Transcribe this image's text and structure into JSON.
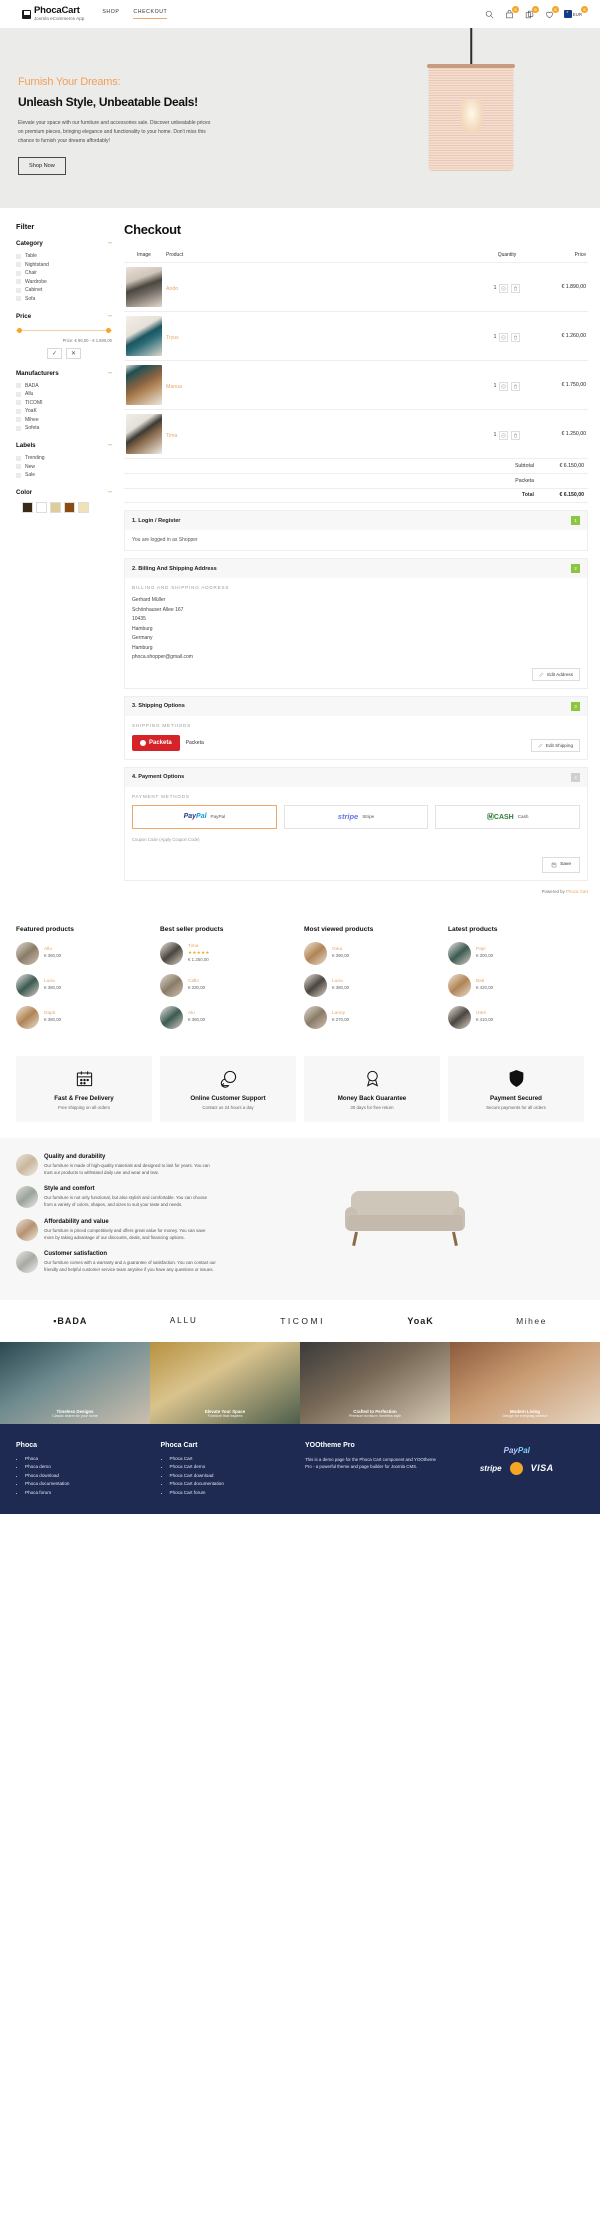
{
  "header": {
    "brand_name": "PhocaCart",
    "brand_sub": "Joomla eCommerce App",
    "nav": [
      {
        "label": "SHOP",
        "active": false
      },
      {
        "label": "CHECKOUT",
        "active": true
      }
    ],
    "icons": {
      "search": "search-icon",
      "cart_badge": "0",
      "compare_badge": "0",
      "wishlist_badge": "0",
      "lang_badge": "0",
      "lang_label": "EUR"
    }
  },
  "hero": {
    "eyebrow": "Furnish Your Dreams:",
    "title": "Unleash Style, Unbeatable Deals!",
    "desc": "Elevate your space with our furniture and accessories sale. Discover unbeatable prices on premium pieces, bringing elegance and functionality to your home. Don't miss this chance to furnish your dreams affordably!",
    "button": "Shop Now"
  },
  "filter": {
    "title": "Filter",
    "groups": [
      {
        "name": "Category",
        "items": [
          "Table",
          "Nightstand",
          "Chair",
          "Wardrobe",
          "Cabinet",
          "Sofa"
        ]
      },
      {
        "name": "Manufacturers",
        "items": [
          "BADA",
          "Allu",
          "TICOMI",
          "YoaK",
          "Mihee",
          "Sofeta"
        ]
      },
      {
        "name": "Labels",
        "items": [
          "Trending",
          "New",
          "Sale"
        ]
      }
    ],
    "price": {
      "name": "Price",
      "range_text": "Price: € 90,00 - € 1.890,00",
      "apply_icon": "check-circle-icon",
      "reset_icon": "cancel-circle-icon"
    },
    "color": {
      "name": "Color",
      "swatches": [
        "#3b2a16",
        "#ffffff",
        "#e0cc9a",
        "#8a4c10",
        "#efe3b6"
      ]
    }
  },
  "checkout": {
    "title": "Checkout",
    "columns": [
      "Image",
      "Product",
      "Quantity",
      "Price"
    ],
    "rows": [
      {
        "thumb": "t1",
        "product": "Ando",
        "qty": "1",
        "price": "€ 1.890,00"
      },
      {
        "thumb": "t2",
        "product": "Tryus",
        "qty": "1",
        "price": "€ 1.260,00"
      },
      {
        "thumb": "t3",
        "product": "Manua",
        "qty": "1",
        "price": "€ 1.750,00"
      },
      {
        "thumb": "t4",
        "product": "Tima",
        "qty": "1",
        "price": "€ 1.250,00"
      }
    ],
    "summary": [
      {
        "label": "Subtotal",
        "value": "€ 6.150,00"
      },
      {
        "label": "Packeta",
        "value": ""
      },
      {
        "label": "Total",
        "value": "€ 6.150,00"
      }
    ],
    "steps": [
      {
        "title": "1. Login / Register",
        "num": "1",
        "note": "You are logged in as Shopper"
      },
      {
        "title": "2. Billing And Shipping Address",
        "num": "2",
        "section_label": "BILLING AND SHIPPING ADDRESS",
        "address": [
          "Gerhard Müller",
          "Schönhauser Allee 167",
          "10435",
          "Hamburg",
          "Germany",
          "Hamburg",
          "phoca.shopper@gmail.com"
        ],
        "edit_label": "Edit Address"
      },
      {
        "title": "3. Shipping Options",
        "num": "3",
        "section_label": "SHIPPING METHODS",
        "method_logo": "Packeta",
        "method_name": "Packeta",
        "edit_label": "Edit Shipping"
      },
      {
        "title": "4. Payment Options",
        "num": "4",
        "section_label": "PAYMENT METHODS",
        "methods": [
          {
            "logo": "PayPal",
            "label": "PayPal",
            "selected": true
          },
          {
            "logo": "stripe",
            "label": "Stripe",
            "selected": false
          },
          {
            "logo": "CASH",
            "label": "Cash",
            "selected": false
          }
        ],
        "coupon_label": "Coupon Code",
        "coupon_hint": "(Apply Coupon Code)",
        "save_label": "Save"
      }
    ],
    "powered_prefix": "Powered by ",
    "powered_link": "Phoca Cart"
  },
  "product_columns": [
    {
      "heading": "Featured products",
      "items": [
        {
          "thumb": "pa",
          "name": "Allu",
          "stars": "",
          "price": "€ 360,00"
        },
        {
          "thumb": "pb",
          "name": "Luea",
          "stars": "",
          "price": "€ 380,00"
        },
        {
          "thumb": "pc",
          "name": "Dapit",
          "stars": "",
          "price": "€ 380,00"
        }
      ]
    },
    {
      "heading": "Best seller products",
      "items": [
        {
          "thumb": "pd",
          "name": "Tima",
          "stars": "★★★★★",
          "price": "€ 1.250,00"
        },
        {
          "thumb": "pa",
          "name": "Callo",
          "stars": "",
          "price": "€ 330,00"
        },
        {
          "thumb": "pb",
          "name": "Alu",
          "stars": "",
          "price": "€ 360,00"
        }
      ]
    },
    {
      "heading": "Most viewed products",
      "items": [
        {
          "thumb": "pc",
          "name": "Giea",
          "stars": "",
          "price": "€ 390,00"
        },
        {
          "thumb": "pd",
          "name": "Luea",
          "stars": "",
          "price": "€ 380,00"
        },
        {
          "thumb": "pa",
          "name": "Lanoy",
          "stars": "",
          "price": "€ 270,00"
        }
      ]
    },
    {
      "heading": "Latest products",
      "items": [
        {
          "thumb": "pb",
          "name": "Pajri",
          "stars": "",
          "price": "€ 300,00"
        },
        {
          "thumb": "pc",
          "name": "Bait",
          "stars": "",
          "price": "€ 420,00"
        },
        {
          "thumb": "pd",
          "name": "Uteri",
          "stars": "",
          "price": "€ 410,00"
        }
      ]
    }
  ],
  "features": [
    {
      "icon": "calendar-icon",
      "title": "Fast & Free Delivery",
      "sub": "Free shipping on all orders"
    },
    {
      "icon": "chat-icon",
      "title": "Online Customer Support",
      "sub": "Contact us 24 hours a day"
    },
    {
      "icon": "medal-icon",
      "title": "Money Back Guarantee",
      "sub": "30 days for free return"
    },
    {
      "icon": "shield-icon",
      "title": "Payment Secured",
      "sub": "Secure payments for all orders"
    }
  ],
  "benefits": [
    {
      "img": "b1",
      "title": "Quality and durability",
      "text": "Our furniture is made of high-quality materials and designed to last for years. You can trust our products to withstand daily use and wear and tear."
    },
    {
      "img": "b2",
      "title": "Style and comfort",
      "text": "Our furniture is not only functional, but also stylish and comfortable. You can choose from a variety of colors, shapes, and sizes to suit your taste and needs."
    },
    {
      "img": "b3",
      "title": "Affordability and value",
      "text": "Our furniture is priced competitively and offers great value for money. You can save more by taking advantage of our discounts, deals, and financing options."
    },
    {
      "img": "b4",
      "title": "Customer satisfaction",
      "text": "Our furniture comes with a warranty and a guarantee of satisfaction. You can contact our friendly and helpful customer service team anytime if you have any questions or issues."
    }
  ],
  "brands": [
    "▪BADA",
    "ALLU",
    "TICOMI",
    "YoaK",
    "Mihee"
  ],
  "strip": [
    {
      "title": "Timeless Designs",
      "sub": "Classic charm for your home"
    },
    {
      "title": "Elevate Your Space",
      "sub": "Furniture that inspires"
    },
    {
      "title": "Crafted to Perfection",
      "sub": "Premium furniture, timeless style"
    },
    {
      "title": "Modern Living",
      "sub": "Design for everyday comfort"
    }
  ],
  "footer": {
    "columns": [
      {
        "heading": "Phoca",
        "items": [
          "Phoca",
          "Phoca demo",
          "Phoca download",
          "Phoca documentation",
          "Phoca forum"
        ]
      },
      {
        "heading": "Phoca Cart",
        "items": [
          "Phoca Cart",
          "Phoca Cart demo",
          "Phoca Cart download",
          "Phoca Cart documentation",
          "Phoca Cart forum"
        ]
      },
      {
        "heading": "YOOtheme Pro",
        "text": "This is a demo page for the Phoca Cart component and YOOtheme Pro - a powerful theme and page builder for Joomla CMS."
      }
    ],
    "payments": [
      "PayPal",
      "stripe",
      "cash",
      "VISA"
    ]
  }
}
